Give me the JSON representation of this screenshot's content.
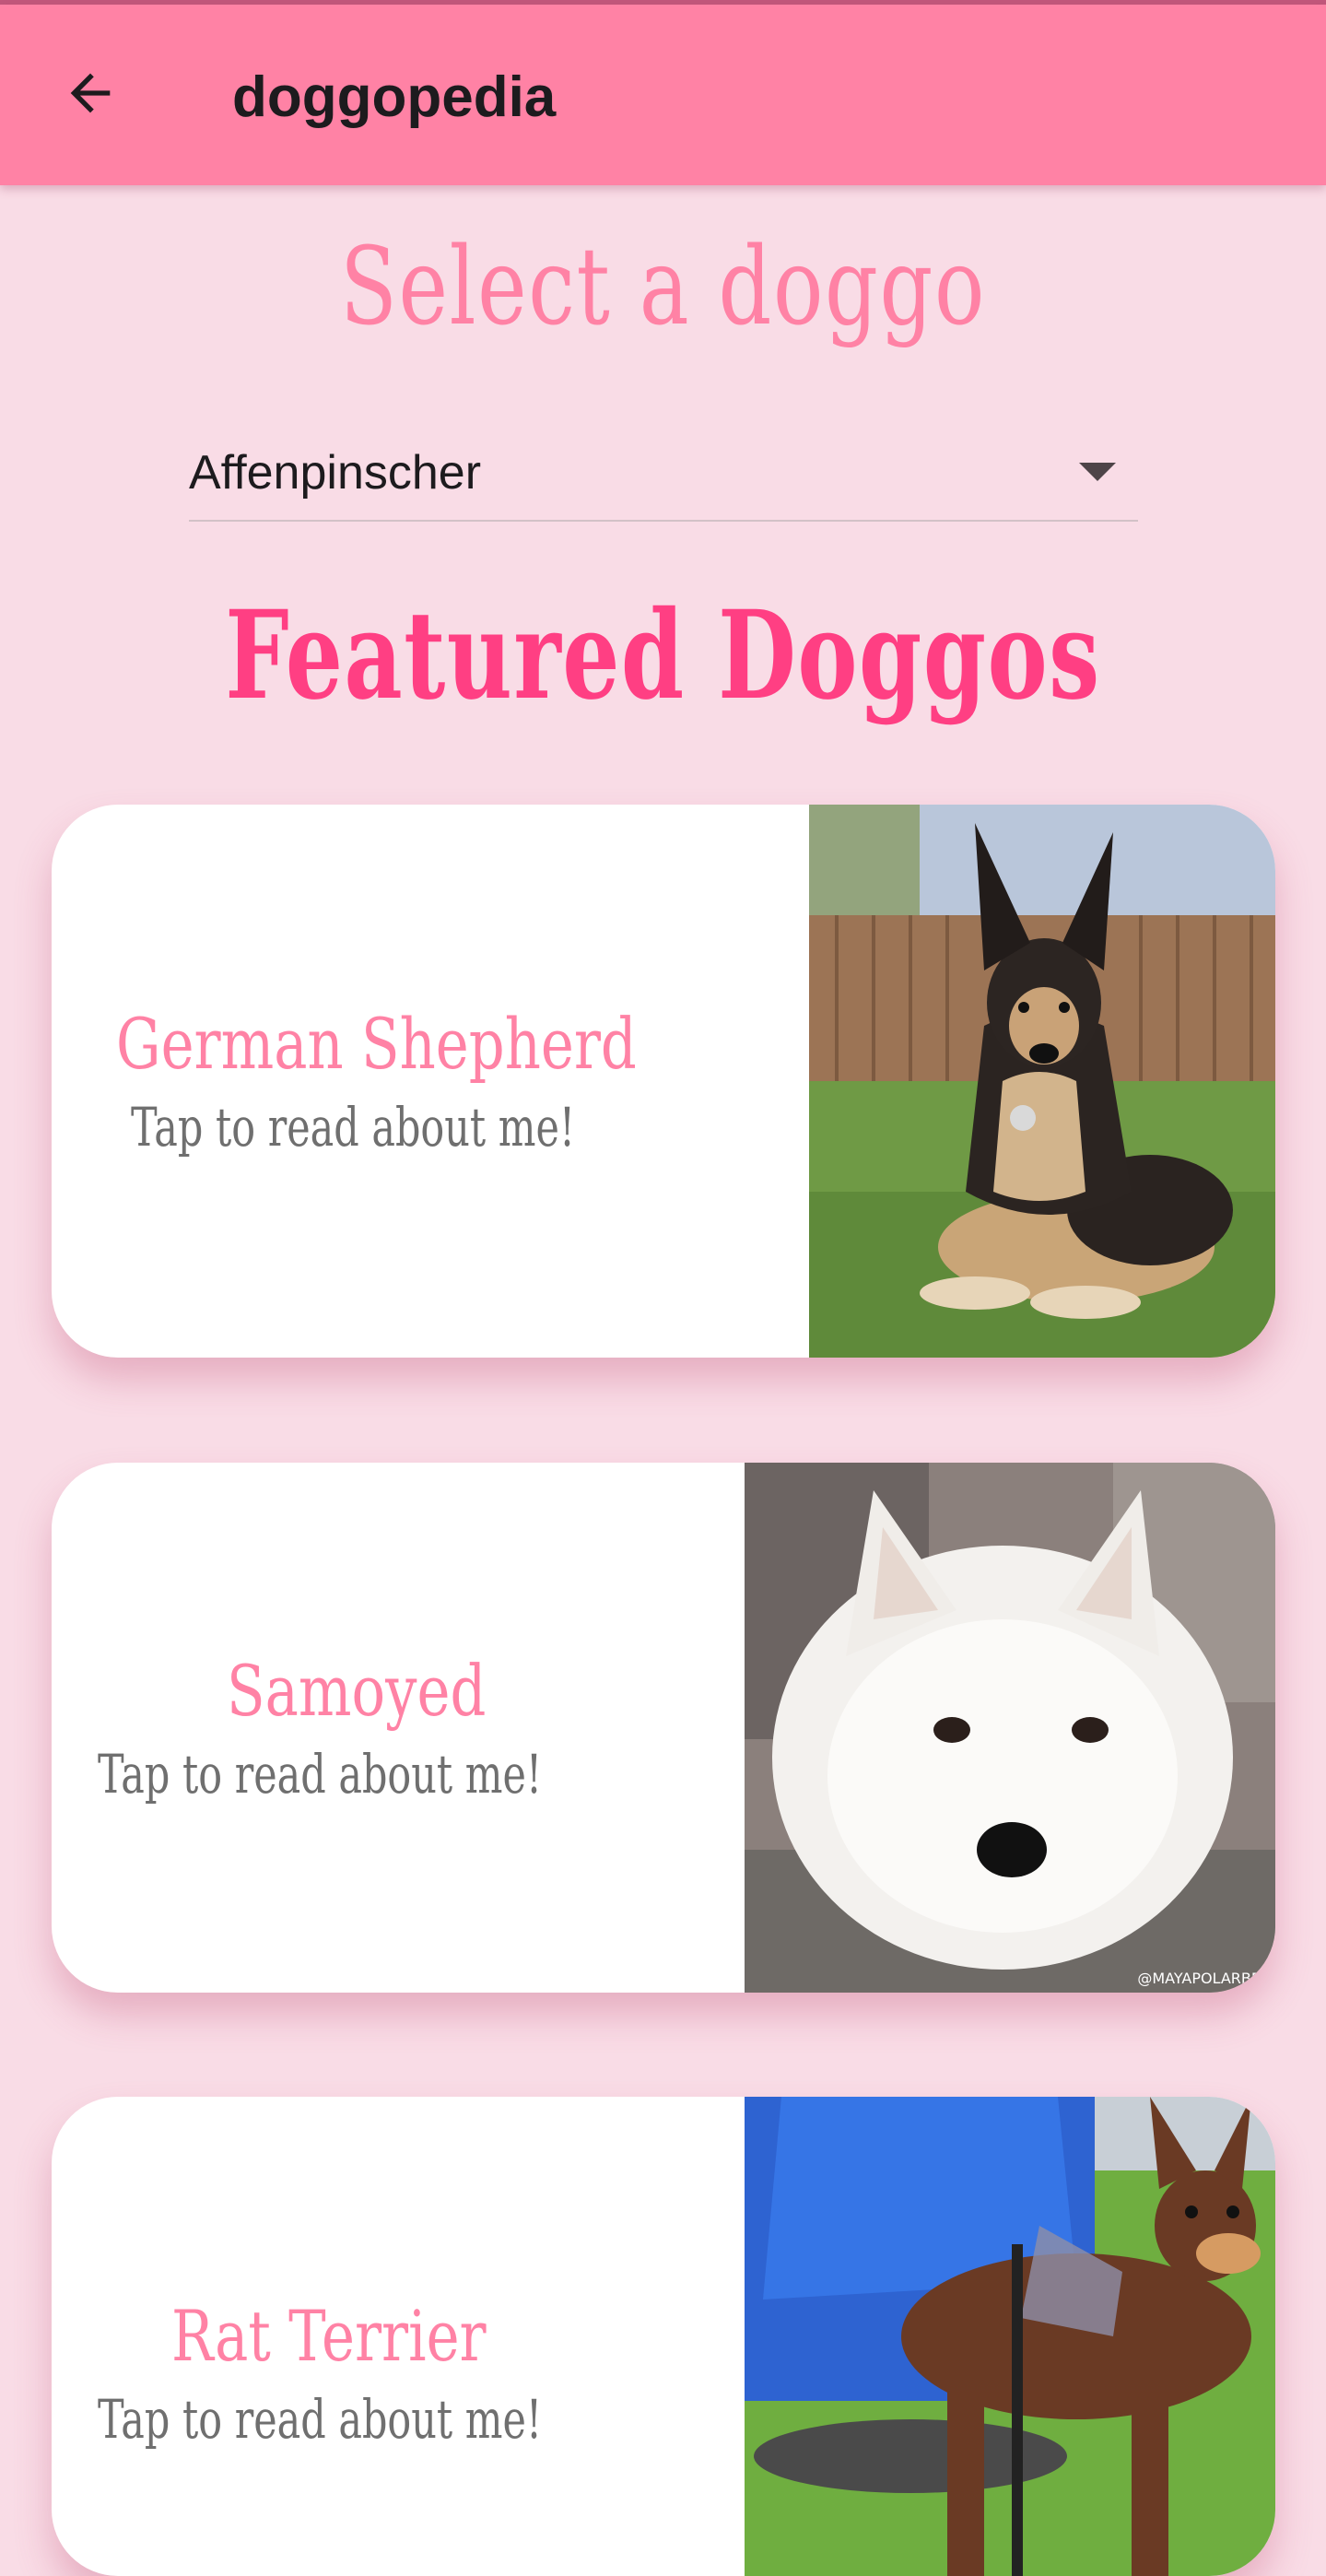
{
  "app_bar": {
    "title": "doggopedia",
    "background_color": "#ff82a5",
    "back_icon": "arrow-back-icon"
  },
  "select_section": {
    "heading": "Select a doggo",
    "dropdown": {
      "selected": "Affenpinscher",
      "icon": "arrow-drop-down-icon"
    }
  },
  "featured_section": {
    "heading": "Featured Doggos",
    "cards": [
      {
        "name": "German Shepherd",
        "subtitle": "Tap to read about me!",
        "image": "german-shepherd-photo"
      },
      {
        "name": "Samoyed",
        "subtitle": "Tap to read about me!",
        "image": "samoyed-photo",
        "image_watermark": "@MAYAPOLARBE"
      },
      {
        "name": "Rat Terrier",
        "subtitle": "Tap to read about me!",
        "image": "rat-terrier-photo"
      }
    ]
  },
  "colors": {
    "page_background": "#f9dce6",
    "accent_pink": "#ff82a5",
    "heading_pink": "#ff3f83",
    "subtitle_gray": "#6f6f6f"
  }
}
